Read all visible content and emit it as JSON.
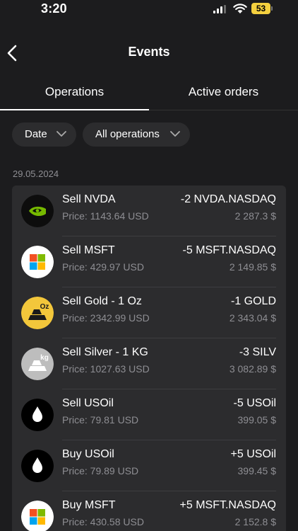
{
  "status_bar": {
    "time": "3:20",
    "battery": "53"
  },
  "nav": {
    "title": "Events"
  },
  "tabs": [
    {
      "label": "Operations",
      "active": true
    },
    {
      "label": "Active orders",
      "active": false
    }
  ],
  "filters": [
    {
      "label": "Date"
    },
    {
      "label": "All operations"
    }
  ],
  "date_group": "29.05.2024",
  "operations": [
    {
      "title": "Sell NVDA",
      "price": "Price: 1143.64 USD",
      "quantity": "-2 NVDA.NASDAQ",
      "amount": "2 287.3 $",
      "icon": "nvidia-logo"
    },
    {
      "title": "Sell MSFT",
      "price": "Price: 429.97 USD",
      "quantity": "-5 MSFT.NASDAQ",
      "amount": "2 149.85 $",
      "icon": "microsoft-logo"
    },
    {
      "title": "Sell Gold - 1 Oz",
      "price": "Price: 2342.99 USD",
      "quantity": "-1 GOLD",
      "amount": "2 343.04 $",
      "icon": "gold-bar-icon",
      "icon_text": "Oz"
    },
    {
      "title": "Sell Silver - 1 KG",
      "price": "Price: 1027.63 USD",
      "quantity": "-3 SILV",
      "amount": "3 082.89 $",
      "icon": "silver-bar-icon",
      "icon_text": "kg"
    },
    {
      "title": "Sell USOil",
      "price": "Price: 79.81 USD",
      "quantity": "-5 USOil",
      "amount": "399.05 $",
      "icon": "oil-drop-icon"
    },
    {
      "title": "Buy USOil",
      "price": "Price: 79.89 USD",
      "quantity": "+5 USOil",
      "amount": "399.45 $",
      "icon": "oil-drop-icon"
    },
    {
      "title": "Buy MSFT",
      "price": "Price: 430.58 USD",
      "quantity": "+5 MSFT.NASDAQ",
      "amount": "2 152.8 $",
      "icon": "microsoft-logo"
    }
  ],
  "colors": {
    "background": "#1c1c1e",
    "card": "#2c2c2e",
    "secondary_text": "#8e8e93",
    "gold": "#f3c73b",
    "silver": "#bdbdbd",
    "nvidia_green": "#76b900"
  }
}
